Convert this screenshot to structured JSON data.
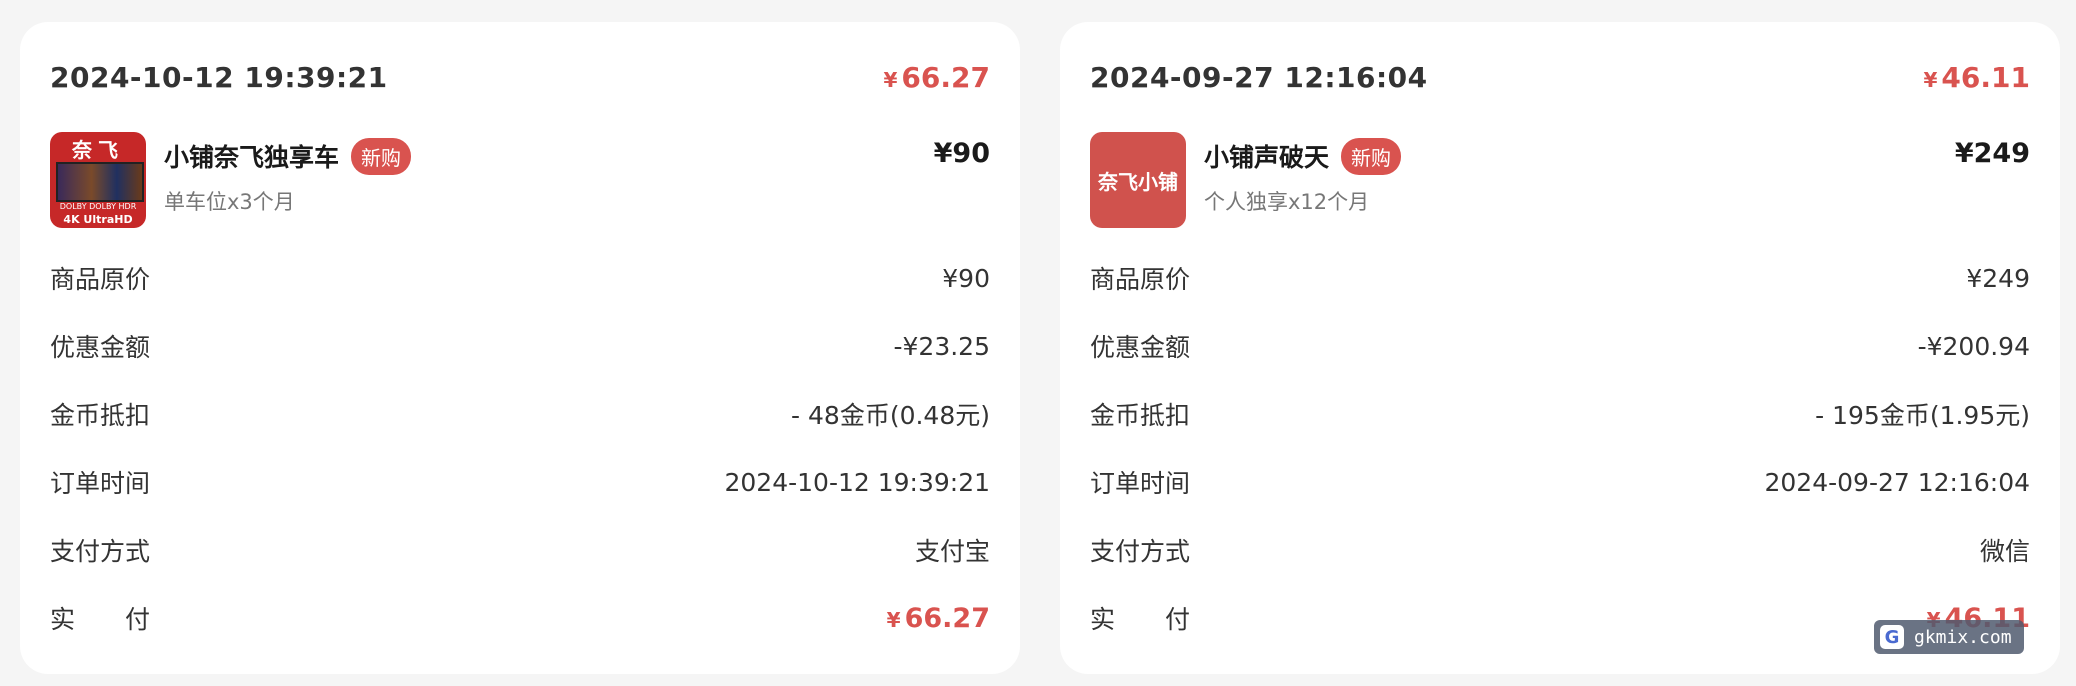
{
  "colors": {
    "accent": "#d9534f",
    "card_bg": "#ffffff",
    "page_bg": "#f5f5f5"
  },
  "orders": [
    {
      "date": "2024-10-12 19:39:21",
      "total_symbol": "¥",
      "total": "66.27",
      "product": {
        "thumb_icon": "nfx-4k-tv-thumbnail",
        "thumb_title": "奈飞",
        "thumb_tags": "DOLBY  DOLBY  HDR",
        "thumb_bottom": "4K UltraHD",
        "name": "小铺奈飞独享车",
        "badge": "新购",
        "spec": "单车位x3个月",
        "price": "¥90"
      },
      "rows": {
        "original_label": "商品原价",
        "original_value": "¥90",
        "discount_label": "优惠金额",
        "discount_value": "-¥23.25",
        "coins_label": "金币抵扣",
        "coins_value": "- 48金币(0.48元)",
        "time_label": "订单时间",
        "time_value": "2024-10-12 19:39:21",
        "method_label": "支付方式",
        "method_value": "支付宝",
        "paid_label": "实　　付",
        "paid_symbol": "¥",
        "paid_value": "66.27"
      }
    },
    {
      "date": "2024-09-27 12:16:04",
      "total_symbol": "¥",
      "total": "46.11",
      "product": {
        "thumb_icon": "nfx-shop-logo",
        "thumb_text": "奈飞小铺",
        "name": "小铺声破天",
        "badge": "新购",
        "spec": "个人独享x12个月",
        "price": "¥249"
      },
      "rows": {
        "original_label": "商品原价",
        "original_value": "¥249",
        "discount_label": "优惠金额",
        "discount_value": "-¥200.94",
        "coins_label": "金币抵扣",
        "coins_value": "- 195金币(1.95元)",
        "time_label": "订单时间",
        "time_value": "2024-09-27 12:16:04",
        "method_label": "支付方式",
        "method_value": "微信",
        "paid_label": "实　　付",
        "paid_symbol": "¥",
        "paid_value": "46.11"
      }
    }
  ],
  "watermark": {
    "icon": "G",
    "text": "gkmix.com"
  }
}
